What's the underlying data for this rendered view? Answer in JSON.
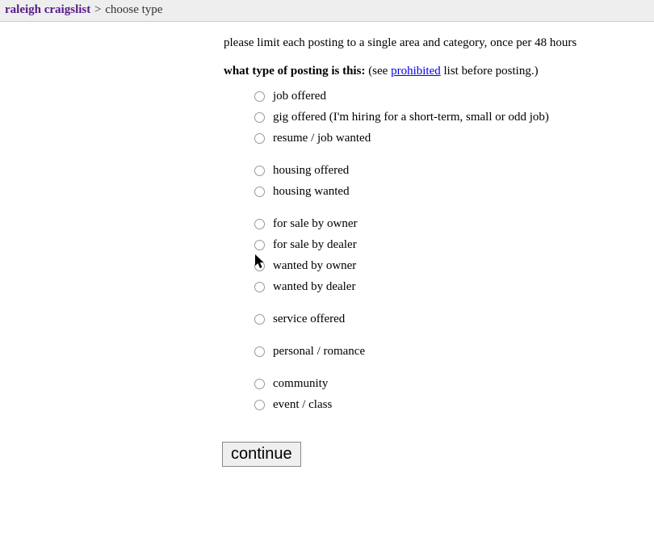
{
  "breadcrumb": {
    "site": "raleigh craigslist",
    "sep": ">",
    "current": "choose type"
  },
  "limit_note": "please limit each posting to a single area and category, once per 48 hours",
  "prompt": {
    "bold": "what type of posting is this:",
    "before_link": " (see ",
    "link": "prohibited",
    "after_link": " list before posting.)"
  },
  "groups": [
    {
      "items": [
        {
          "label": "job offered"
        },
        {
          "label": "gig offered (I'm hiring for a short-term, small or odd job)"
        },
        {
          "label": "resume / job wanted"
        }
      ]
    },
    {
      "items": [
        {
          "label": "housing offered"
        },
        {
          "label": "housing wanted"
        }
      ]
    },
    {
      "items": [
        {
          "label": "for sale by owner"
        },
        {
          "label": "for sale by dealer"
        },
        {
          "label": "wanted by owner"
        },
        {
          "label": "wanted by dealer"
        }
      ]
    },
    {
      "items": [
        {
          "label": "service offered"
        }
      ]
    },
    {
      "items": [
        {
          "label": "personal / romance"
        }
      ]
    },
    {
      "items": [
        {
          "label": "community"
        },
        {
          "label": "event / class"
        }
      ]
    }
  ],
  "continue_label": "continue"
}
